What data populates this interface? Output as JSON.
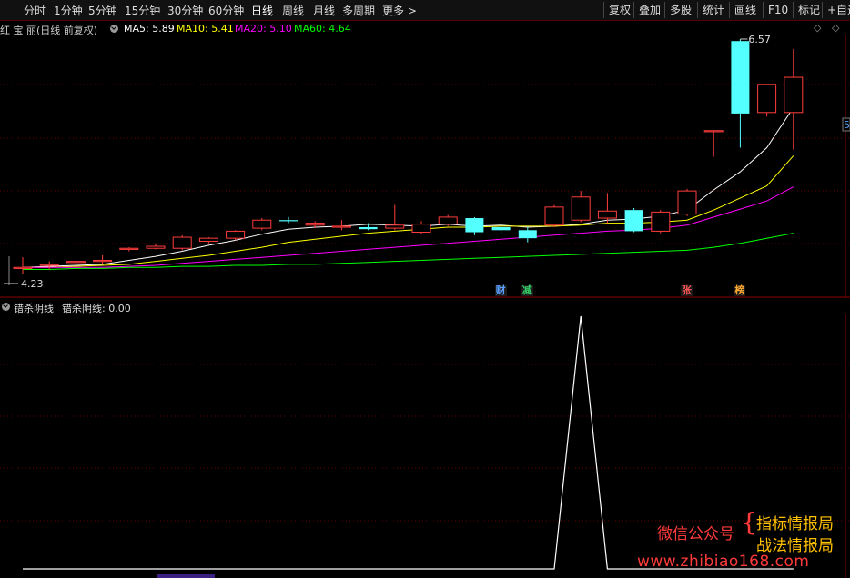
{
  "toolbar": {
    "periods": [
      "分时",
      "1分钟",
      "5分钟",
      "15分钟",
      "30分钟",
      "60分钟",
      "日线",
      "周线",
      "月线",
      "多周期",
      "更多"
    ],
    "active_period": "日线",
    "right_buttons": [
      "复权",
      "叠加",
      "多股",
      "统计",
      "画线",
      "F10",
      "标记",
      "+自选"
    ]
  },
  "main_panel": {
    "stock_title": "红 宝 丽(日线 前复权)",
    "ma": [
      {
        "label": "MA5: 5.89",
        "color": "#ffffff"
      },
      {
        "label": "MA10: 5.41",
        "color": "#ffff00"
      },
      {
        "label": "MA20: 5.10",
        "color": "#ff00ff"
      },
      {
        "label": "MA60: 4.64",
        "color": "#00ff00"
      }
    ],
    "high_label": "6.57",
    "low_label": "4.23",
    "right_edge_label": "5",
    "event_tags": [
      {
        "text": "财",
        "color": "#5aa0ff"
      },
      {
        "text": "减",
        "color": "#33cc66"
      },
      {
        "text": "张",
        "color": "#ff5555"
      },
      {
        "text": "榜",
        "color": "#ffaa33"
      }
    ]
  },
  "indicator_panel": {
    "name": "错杀阴线",
    "value_label": "错杀阴线: 0.00"
  },
  "watermark": {
    "line1": "微信公众号",
    "line2": "指标情报局",
    "line3": "战法情报局",
    "url": "www.zhibiao168.com"
  },
  "chart_data": {
    "type": "candlestick",
    "price_range": [
      4.23,
      6.57
    ],
    "candles": [
      {
        "o": 4.3,
        "h": 4.4,
        "l": 4.23,
        "c": 4.3
      },
      {
        "o": 4.32,
        "h": 4.36,
        "l": 4.28,
        "c": 4.33
      },
      {
        "o": 4.35,
        "h": 4.38,
        "l": 4.31,
        "c": 4.36
      },
      {
        "o": 4.36,
        "h": 4.42,
        "l": 4.33,
        "c": 4.37
      },
      {
        "o": 4.48,
        "h": 4.5,
        "l": 4.46,
        "c": 4.49
      },
      {
        "o": 4.49,
        "h": 4.54,
        "l": 4.48,
        "c": 4.51
      },
      {
        "o": 4.49,
        "h": 4.62,
        "l": 4.47,
        "c": 4.6
      },
      {
        "o": 4.56,
        "h": 4.6,
        "l": 4.54,
        "c": 4.59
      },
      {
        "o": 4.59,
        "h": 4.67,
        "l": 4.57,
        "c": 4.66
      },
      {
        "o": 4.69,
        "h": 4.79,
        "l": 4.67,
        "c": 4.77
      },
      {
        "o": 4.77,
        "h": 4.8,
        "l": 4.74,
        "c": 4.76
      },
      {
        "o": 4.72,
        "h": 4.76,
        "l": 4.69,
        "c": 4.74
      },
      {
        "o": 4.7,
        "h": 4.77,
        "l": 4.67,
        "c": 4.71
      },
      {
        "o": 4.7,
        "h": 4.74,
        "l": 4.67,
        "c": 4.68
      },
      {
        "o": 4.69,
        "h": 4.92,
        "l": 4.67,
        "c": 4.72
      },
      {
        "o": 4.65,
        "h": 4.76,
        "l": 4.63,
        "c": 4.73
      },
      {
        "o": 4.73,
        "h": 4.82,
        "l": 4.71,
        "c": 4.8
      },
      {
        "o": 4.79,
        "h": 4.8,
        "l": 4.62,
        "c": 4.65
      },
      {
        "o": 4.7,
        "h": 4.73,
        "l": 4.63,
        "c": 4.67
      },
      {
        "o": 4.67,
        "h": 4.7,
        "l": 4.55,
        "c": 4.59
      },
      {
        "o": 4.72,
        "h": 4.92,
        "l": 4.7,
        "c": 4.9
      },
      {
        "o": 4.77,
        "h": 5.06,
        "l": 4.75,
        "c": 5.0
      },
      {
        "o": 4.79,
        "h": 5.04,
        "l": 4.74,
        "c": 4.86
      },
      {
        "o": 4.87,
        "h": 4.89,
        "l": 4.65,
        "c": 4.66
      },
      {
        "o": 4.66,
        "h": 4.87,
        "l": 4.64,
        "c": 4.85
      },
      {
        "o": 4.83,
        "h": 5.08,
        "l": 4.81,
        "c": 5.06
      },
      {
        "o": 5.66,
        "h": 5.66,
        "l": 5.4,
        "c": 5.66
      },
      {
        "o": 6.55,
        "h": 6.57,
        "l": 5.49,
        "c": 5.83
      },
      {
        "o": 5.84,
        "h": 6.12,
        "l": 5.8,
        "c": 6.12
      },
      {
        "o": 5.84,
        "h": 6.47,
        "l": 5.47,
        "c": 6.19
      }
    ],
    "ma_lines": [
      {
        "name": "MA5",
        "color": "#ffffff",
        "values": [
          4.3,
          4.31,
          4.32,
          4.33,
          4.37,
          4.41,
          4.46,
          4.52,
          4.57,
          4.63,
          4.68,
          4.7,
          4.71,
          4.73,
          4.72,
          4.71,
          4.73,
          4.71,
          4.72,
          4.7,
          4.71,
          4.73,
          4.77,
          4.78,
          4.81,
          4.87,
          5.07,
          5.25,
          5.49,
          5.89
        ]
      },
      {
        "name": "MA10",
        "color": "#ffff00",
        "values": [
          4.3,
          4.3,
          4.31,
          4.32,
          4.33,
          4.36,
          4.39,
          4.42,
          4.46,
          4.5,
          4.55,
          4.58,
          4.61,
          4.64,
          4.66,
          4.68,
          4.7,
          4.7,
          4.71,
          4.71,
          4.71,
          4.72,
          4.74,
          4.74,
          4.75,
          4.77,
          4.87,
          4.99,
          5.11,
          5.41
        ]
      },
      {
        "name": "MA20",
        "color": "#ff00ff",
        "values": [
          4.3,
          4.3,
          4.3,
          4.3,
          4.31,
          4.32,
          4.34,
          4.36,
          4.38,
          4.4,
          4.42,
          4.44,
          4.46,
          4.48,
          4.5,
          4.52,
          4.54,
          4.56,
          4.58,
          4.6,
          4.62,
          4.64,
          4.66,
          4.67,
          4.69,
          4.72,
          4.8,
          4.88,
          4.96,
          5.1
        ]
      },
      {
        "name": "MA60",
        "color": "#00ff00",
        "values": [
          4.28,
          4.28,
          4.29,
          4.29,
          4.3,
          4.3,
          4.31,
          4.31,
          4.32,
          4.32,
          4.33,
          4.33,
          4.34,
          4.35,
          4.36,
          4.37,
          4.38,
          4.39,
          4.4,
          4.41,
          4.42,
          4.43,
          4.44,
          4.45,
          4.46,
          4.47,
          4.5,
          4.54,
          4.59,
          4.64
        ]
      }
    ],
    "indicator": {
      "name": "错杀阴线",
      "values": [
        0,
        0,
        0,
        0,
        0,
        0,
        0,
        0,
        0,
        0,
        0,
        0,
        0,
        0,
        0,
        0,
        0,
        0,
        0,
        0,
        0,
        1,
        0,
        0,
        0,
        0,
        0,
        0,
        0,
        0
      ]
    }
  }
}
